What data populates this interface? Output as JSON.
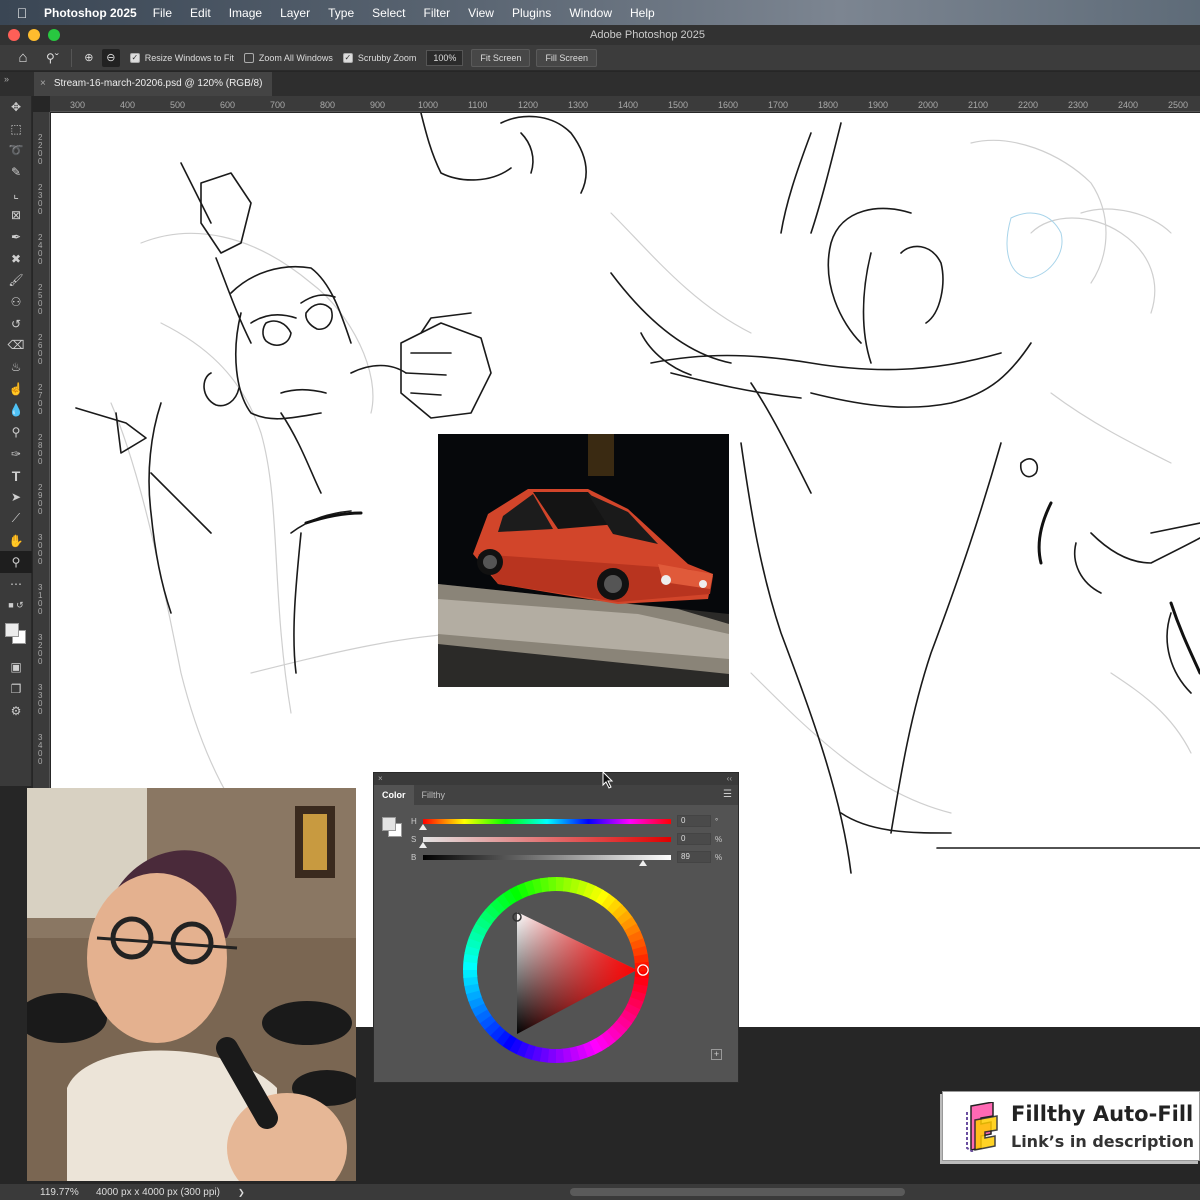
{
  "menubar": {
    "app": "Photoshop 2025",
    "items": [
      "File",
      "Edit",
      "Image",
      "Layer",
      "Type",
      "Select",
      "Filter",
      "View",
      "Plugins",
      "Window",
      "Help"
    ]
  },
  "window": {
    "title": "Adobe Photoshop 2025"
  },
  "options": {
    "resize_windows": "Resize Windows to Fit",
    "zoom_all": "Zoom All Windows",
    "scrubby": "Scrubby Zoom",
    "zoom_value": "100%",
    "fit_screen": "Fit Screen",
    "fill_screen": "Fill Screen"
  },
  "document": {
    "tab_title": "Stream-16-march-20206.psd @ 120% (RGB/8)"
  },
  "ruler": {
    "h": [
      "300",
      "400",
      "500",
      "600",
      "700",
      "800",
      "900",
      "1000",
      "1100",
      "1200",
      "1300",
      "1400",
      "1500",
      "1600",
      "1700",
      "1800",
      "1900",
      "2000",
      "2100",
      "2200",
      "2300",
      "2400",
      "2500"
    ],
    "v": [
      "2200",
      "2300",
      "2400",
      "2500",
      "2600",
      "2700",
      "2800",
      "2900",
      "3000",
      "3100",
      "3200",
      "3300",
      "3400"
    ]
  },
  "color_panel": {
    "tabs": [
      "Color",
      "Fillthy"
    ],
    "h": {
      "label": "H",
      "value": "0",
      "unit": "°"
    },
    "s": {
      "label": "S",
      "value": "0",
      "unit": "%"
    },
    "b": {
      "label": "B",
      "value": "89",
      "unit": "%"
    }
  },
  "status": {
    "zoom": "119.77%",
    "doc_info": "4000 px x 4000 px (300 ppi)",
    "arrow": "❯"
  },
  "promo": {
    "title": "Fillthy Auto-Fill P",
    "subtitle": "Link’s in description 👇"
  }
}
